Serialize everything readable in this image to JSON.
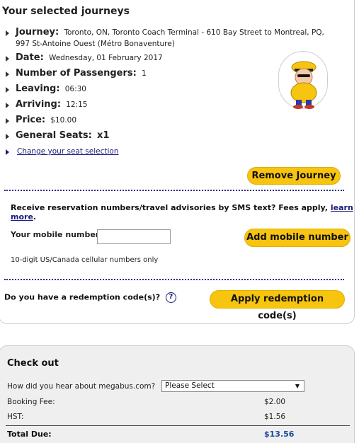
{
  "journeys": {
    "title": "Your selected journeys",
    "items": {
      "journey": {
        "label": "Journey:",
        "value": "Toronto, ON, Toronto Coach Terminal - 610 Bay Street to Montreal, PQ, 997 St-Antoine Ouest (Métro Bonaventure)"
      },
      "date": {
        "label": "Date:",
        "value": "Wednesday, 01 February 2017"
      },
      "passengers": {
        "label": "Number of Passengers:",
        "value": "1"
      },
      "leaving": {
        "label": "Leaving:",
        "value": "06:30"
      },
      "arriving": {
        "label": "Arriving:",
        "value": "12:15"
      },
      "price": {
        "label": "Price:",
        "value": "$10.00"
      },
      "seats": {
        "label": "General Seats:",
        "value": "x1"
      }
    },
    "change_seat_link": "Change your seat selection",
    "remove_button": "Remove Journey"
  },
  "sms": {
    "text": "Receive reservation numbers/travel advisories by SMS text? Fees apply, ",
    "learn_more": "learn more",
    "period": ".",
    "mobile_label": "Your mobile number",
    "mobile_value": "",
    "add_button": "Add mobile number",
    "hint": "10-digit US/Canada cellular numbers only"
  },
  "redemption": {
    "question": "Do you have a redemption code(s)?",
    "help_icon_glyph": "?",
    "apply_button": "Apply redemption code(s)"
  },
  "checkout": {
    "title": "Check out",
    "hear_question": "How did you hear about megabus.com?",
    "hear_select_value": "Please Select",
    "booking_fee_label": "Booking Fee:",
    "booking_fee_value": "$2.00",
    "hst_label": "HST:",
    "hst_value": "$1.56",
    "total_label": "Total Due:",
    "total_value": "$13.56"
  },
  "colors": {
    "button_yellow": "#f7c410",
    "link_blue": "#1a1a7a",
    "divider_blue": "#2a2a8a",
    "total_blue": "#1a4a9a"
  },
  "icons": [
    "megabus-mascot-icon",
    "help-icon",
    "chevron-down-icon",
    "bullet-triangle-icon"
  ]
}
